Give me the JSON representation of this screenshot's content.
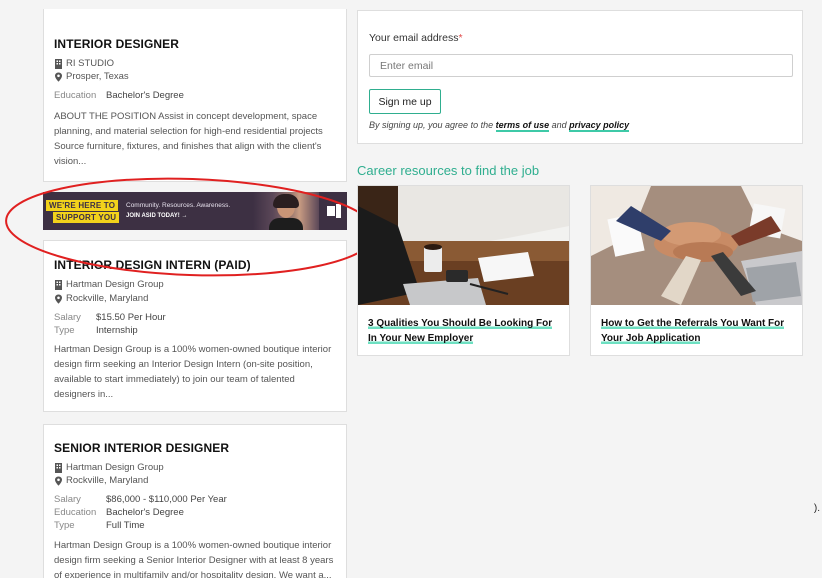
{
  "jobs": [
    {
      "title": "INTERIOR DESIGNER",
      "company": "RI STUDIO",
      "location": "Prosper, Texas",
      "fields": [
        {
          "key": "Education",
          "value": "Bachelor's Degree"
        }
      ],
      "description": "ABOUT THE POSITION Assist in concept development, space planning, and material selection for high-end residential projects Source furniture, fixtures, and finishes that align with the client's vision..."
    },
    {
      "title": "INTERIOR DESIGN INTERN (PAID)",
      "company": "Hartman Design Group",
      "location": "Rockville, Maryland",
      "fields": [
        {
          "key": "Salary",
          "value": "$15.50 Per Hour"
        },
        {
          "key": "Type",
          "value": "Internship"
        }
      ],
      "description": "Hartman Design Group is a 100% women-owned boutique interior design firm seeking an Interior Design Intern (on-site position, available to start immediately) to join our team of talented designers in..."
    },
    {
      "title": "SENIOR INTERIOR DESIGNER",
      "company": "Hartman Design Group",
      "location": "Rockville, Maryland",
      "fields": [
        {
          "key": "Salary",
          "value": "$86,000 - $110,000 Per Year"
        },
        {
          "key": "Education",
          "value": "Bachelor's Degree"
        },
        {
          "key": "Type",
          "value": "Full Time"
        }
      ],
      "description": "Hartman Design Group is a 100% women-owned boutique interior design firm seeking a Senior Interior Designer with at least 8 years of experience in multifamily and/or hospitality design. We want a..."
    }
  ],
  "banner": {
    "line1": "WE'RE HERE TO",
    "line2": "SUPPORT YOU",
    "tagline": "Community. Resources. Awareness.",
    "cta": "JOIN ASID TODAY! →"
  },
  "newsletter": {
    "email_label": "Your email address",
    "required_mark": "*",
    "email_placeholder": "Enter email",
    "email_value": "",
    "signup_label": "Sign me up",
    "disclaimer_prefix": "By signing up, you agree to the ",
    "terms_label": "terms of use",
    "disclaimer_and": " and ",
    "privacy_label": "privacy policy"
  },
  "career": {
    "heading": "Career resources to find the job",
    "articles": [
      {
        "title": "3 Qualities You Should Be Looking For In Your New Employer",
        "image": "desk-coffee-laptop-photo"
      },
      {
        "title": "How to Get the Referrals You Want For Your Job Application",
        "image": "team-hands-stack-photo"
      }
    ]
  },
  "colors": {
    "accent": "#2fae8f",
    "highlight": "#6ee0c2",
    "banner_bg": "#3d3043",
    "banner_yellow": "#f2d21b",
    "annotation": "#e02020",
    "required": "#e04a4a"
  },
  "stray_text": ")."
}
